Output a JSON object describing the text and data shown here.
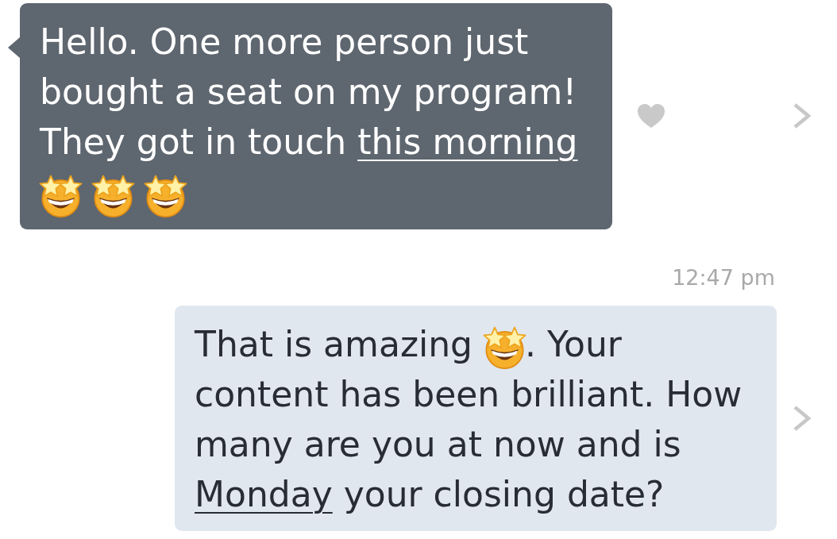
{
  "thread": [
    {
      "kind": "received",
      "liked": false,
      "segments": [
        {
          "kind": "text",
          "text": "Hello. One more person just bought a seat on my program! They got in touch "
        },
        {
          "kind": "link",
          "text": "this morning"
        },
        {
          "kind": "emoji"
        },
        {
          "kind": "emoji"
        },
        {
          "kind": "emoji"
        }
      ]
    },
    {
      "kind": "timestamp",
      "text": "12:47 pm"
    },
    {
      "kind": "sent",
      "segments": [
        {
          "kind": "text",
          "text": "That is amazing "
        },
        {
          "kind": "emoji"
        },
        {
          "kind": "text",
          "text": ". Your content has been brilliant. How many are you at now and is "
        },
        {
          "kind": "link",
          "text": "Monday"
        },
        {
          "kind": "text",
          "text": " your closing date?"
        }
      ]
    }
  ]
}
